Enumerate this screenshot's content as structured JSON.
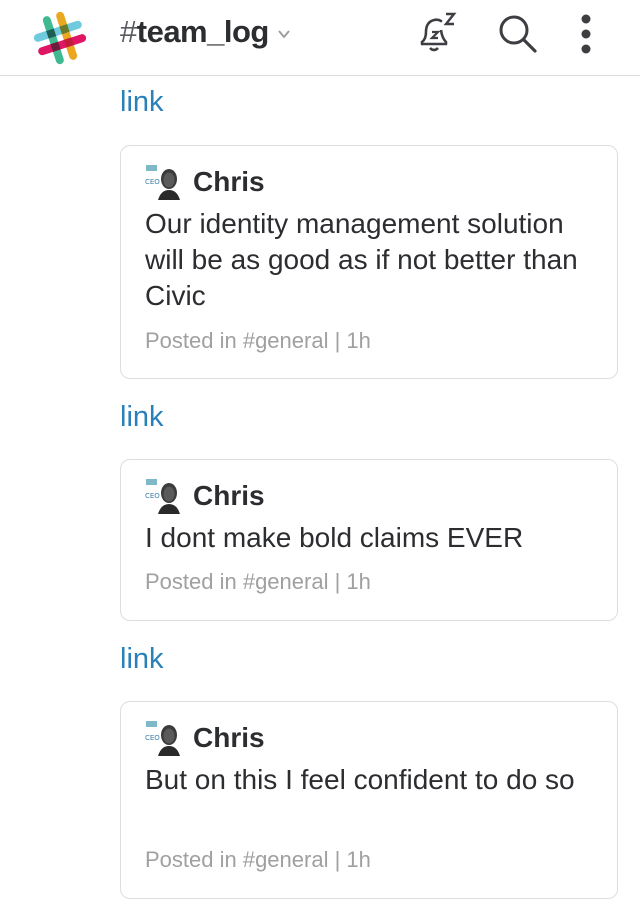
{
  "header": {
    "channel_hash": "#",
    "channel_name": "team_log"
  },
  "icons": {
    "logo": "slack-logo",
    "chevron": "chevron-down-icon",
    "snooze": "snooze-bell-icon",
    "search": "search-icon",
    "more": "more-vertical-icon"
  },
  "messages": [
    {
      "link_label": "link",
      "author": "Chris",
      "text": "Our identity management solution will be as good as if not better than Civic",
      "meta": "Posted in #general | 1h"
    },
    {
      "link_label": "link",
      "author": "Chris",
      "text": "I dont make bold claims EVER",
      "meta": "Posted in #general | 1h"
    },
    {
      "link_label": "link",
      "author": "Chris",
      "text": "But on this I feel confident to do so",
      "meta": "Posted in #general | 1h"
    }
  ],
  "colors": {
    "link": "#2a80b9",
    "meta": "#a0a0a2",
    "text": "#2c2d30"
  }
}
